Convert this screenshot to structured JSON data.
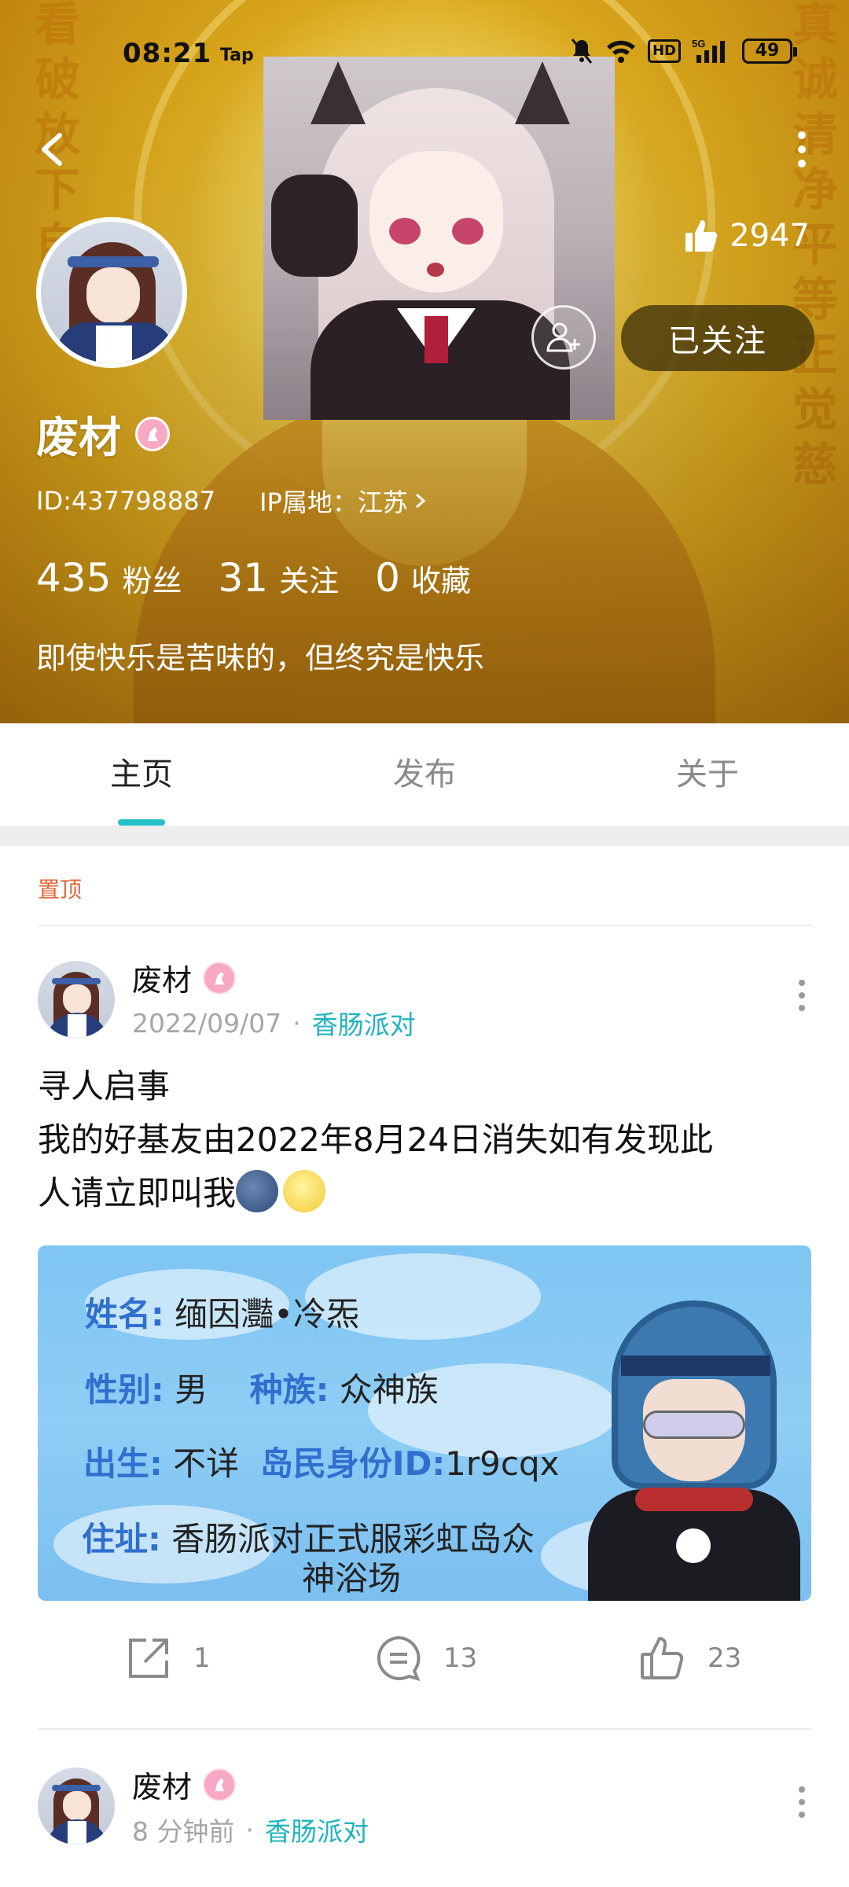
{
  "status_bar": {
    "time": "08:21",
    "app_label": "Tap",
    "hd_label": "HD",
    "network_label": "5G",
    "battery": "49"
  },
  "profile": {
    "username": "废材",
    "id_text": "ID:437798887",
    "ip_text": "IP属地：江苏",
    "likes": "2947",
    "follow_button": "已关注",
    "fans_count": "435",
    "fans_label": "粉丝",
    "following_count": "31",
    "following_label": "关注",
    "favorites_count": "0",
    "favorites_label": "收藏",
    "bio": "即使快乐是苦味的，但终究是快乐"
  },
  "tabs": [
    {
      "label": "主页",
      "active": true
    },
    {
      "label": "发布",
      "active": false
    },
    {
      "label": "关于",
      "active": false
    }
  ],
  "feed": {
    "pinned_label": "置顶",
    "posts": [
      {
        "author": "废材",
        "date": "2022/09/07",
        "group": "香肠派对",
        "title": "寻人启事",
        "body_line1": "我的好基友由2022年8月24日消失如有发现此",
        "body_line2": "人请立即叫我",
        "image_card": {
          "name_key": "姓名:",
          "name_val": "缅因灩•冷炁",
          "gender_key": "性别:",
          "gender_val": "男",
          "race_key": "种族:",
          "race_val": "众神族",
          "birth_key": "出生:",
          "birth_val": "不详",
          "island_id_key": "岛民身份ID:",
          "island_id_val": "1r9cqx",
          "address_key": "住址:",
          "address_line1": "香肠派对正式服彩虹岛众",
          "address_line2": "神浴场"
        },
        "shares": "1",
        "comments": "13",
        "likes": "23"
      },
      {
        "author": "废材",
        "date": "8 分钟前",
        "group": "香肠派对"
      }
    ]
  },
  "colors": {
    "accent": "#25c0c8",
    "group_link": "#20b3bd",
    "pinned": "#e2663b",
    "follow_button_bg": "#46370a"
  },
  "icons": [
    "back-arrow-icon",
    "more-vertical-icon",
    "thumbs-up-icon",
    "add-friend-icon",
    "share-icon",
    "comment-icon",
    "like-icon",
    "chevron-right-icon",
    "gender-badge-icon"
  ]
}
